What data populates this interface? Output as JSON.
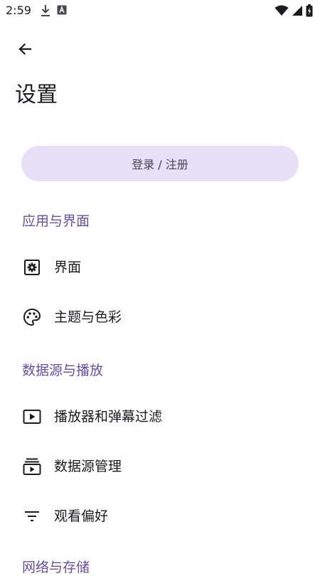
{
  "status_bar": {
    "time": "2:59",
    "left_icons": [
      "download-icon",
      "font-icon"
    ],
    "right_icons": [
      "wifi-icon",
      "signal-icon",
      "battery-charging-icon"
    ]
  },
  "header": {
    "back_icon": "arrow-left-icon",
    "title": "设置"
  },
  "login": {
    "label": "登录 / 注册"
  },
  "sections": {
    "app_ui": {
      "title": "应用与界面",
      "items": [
        {
          "label": "界面",
          "icon": "settings-box-icon"
        },
        {
          "label": "主题与色彩",
          "icon": "palette-icon"
        }
      ]
    },
    "data_source": {
      "title": "数据源与播放",
      "items": [
        {
          "label": "播放器和弹幕过滤",
          "icon": "play-box-icon"
        },
        {
          "label": "数据源管理",
          "icon": "subscriptions-icon"
        },
        {
          "label": "观看偏好",
          "icon": "filter-list-icon"
        }
      ]
    },
    "network": {
      "title": "网络与存储"
    }
  },
  "colors": {
    "accent": "#6750a4",
    "button_bg": "#e6dff5",
    "text": "#1b1b1f",
    "icon": "#49454f"
  }
}
